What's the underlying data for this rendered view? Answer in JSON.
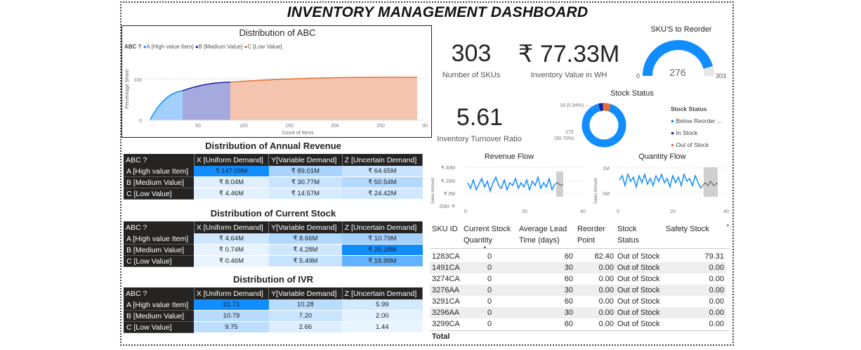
{
  "dashboard_title": "INVENTORY MANAGEMENT DASHBOARD",
  "abc_chart": {
    "title": "Distribution of ABC",
    "legend_title": "ABC ?",
    "legend": [
      {
        "label": "A [High value Item]",
        "color": "#118DFF"
      },
      {
        "label": "B [Medium Value]",
        "color": "#12239E"
      },
      {
        "label": "C [Low Value]",
        "color": "#E66C37"
      }
    ],
    "ylabel": "Percentage Share",
    "xlabel": "Count of Items",
    "y_ticks": [
      "0",
      "100"
    ],
    "x_ticks": [
      "50",
      "100",
      "150",
      "200",
      "250",
      "30"
    ]
  },
  "kpis": {
    "sku_count": {
      "value": "303",
      "label": "Number of SKUs"
    },
    "inventory_value": {
      "value": "₹ 77.33M",
      "label": "Inventory Value in WH"
    },
    "turnover": {
      "value": "5.61",
      "label": "Inventory Turnover Ratio"
    }
  },
  "gauge": {
    "title": "SKU'S to Reorder",
    "min": "0",
    "max": "303",
    "value": "276",
    "fraction": 0.911
  },
  "stock_status": {
    "title": "Stock Status",
    "legend_title": "Stock Status",
    "label_top": "18 (5.94%)",
    "label_bottom_1": "275",
    "label_bottom_2": "(90.76%)",
    "items": [
      {
        "label": "Below Reorder ...",
        "color": "#118DFF",
        "value": 275
      },
      {
        "label": "In Stock",
        "color": "#12239E",
        "value": 10
      },
      {
        "label": "Out of Stock",
        "color": "#E66C37",
        "value": 18
      }
    ]
  },
  "revenue_flow": {
    "title": "Revenue Flow",
    "ylabel": "Sales Amount",
    "y_ticks": [
      "₹ 40M",
      "₹ 20M",
      "₹ 0M",
      "20M -₹"
    ],
    "x_ticks": [
      "0",
      "20",
      "40"
    ]
  },
  "quantity_flow": {
    "title": "Quantity Flow",
    "ylabel": "Sales Amount",
    "y_ticks": [
      "1M",
      "0M"
    ],
    "x_ticks": [
      "0",
      "20",
      "40"
    ]
  },
  "matrices": {
    "columns": [
      "ABC ?",
      "X [Uniform Demand]",
      "Y[Variable Demand]",
      "Z [Uncertain Demand]"
    ],
    "rows": [
      "A [High value Item]",
      "B [Medium Value]",
      "C [Low Value]"
    ],
    "revenue": {
      "title": "Distribution of Annual Revenue",
      "values": [
        [
          "₹ 147.09M",
          "₹ 89.01M",
          "₹ 64.65M"
        ],
        [
          "₹ 8.04M",
          "₹ 30.77M",
          "₹ 50.54M"
        ],
        [
          "₹ 4.46M",
          "₹ 14.57M",
          "₹ 24.42M"
        ]
      ],
      "colors": [
        [
          "#118DFF",
          "#a9d4ff",
          "#c7e3ff"
        ],
        [
          "#dfefff",
          "#c9e4ff",
          "#b3d9ff"
        ],
        [
          "#e3f1ff",
          "#d6ebff",
          "#cfe7ff"
        ]
      ]
    },
    "stock": {
      "title": "Distribution of Current Stock",
      "values": [
        [
          "₹ 4.64M",
          "₹ 8.66M",
          "₹ 10.79M"
        ],
        [
          "₹ 0.74M",
          "₹ 4.28M",
          "₹ 25.28M"
        ],
        [
          "₹ 0.46M",
          "₹ 5.49M",
          "₹ 16.99M"
        ]
      ],
      "colors": [
        [
          "#cfe7ff",
          "#b1d8ff",
          "#a4d1ff"
        ],
        [
          "#e6f3ff",
          "#cfe7ff",
          "#118DFF"
        ],
        [
          "#e8f4ff",
          "#c5e2ff",
          "#62b3ff"
        ]
      ]
    },
    "ivr": {
      "title": "Distribution of IVR",
      "values": [
        [
          "31.71",
          "10.28",
          "5.99"
        ],
        [
          "10.79",
          "7.20",
          "2.00"
        ],
        [
          "9.75",
          "2.66",
          "1.44"
        ]
      ],
      "colors": [
        [
          "#118DFF",
          "#b9dcff",
          "#d3e9ff"
        ],
        [
          "#b8dcff",
          "#c9e4ff",
          "#e4f1ff"
        ],
        [
          "#bddeff",
          "#deeeff",
          "#e8f4ff"
        ]
      ]
    }
  },
  "sku_table": {
    "headers": [
      "SKU ID",
      "Current Stock Quantity",
      "Average Lead Time (days)",
      "Reorder Point",
      "Stock Status",
      "Safety Stock"
    ],
    "header_lines": [
      [
        "SKU ID"
      ],
      [
        "Current Stock",
        "Quantity"
      ],
      [
        "Average Lead",
        "Time (days)"
      ],
      [
        "Reorder",
        "Point"
      ],
      [
        "Stock",
        "Status"
      ],
      [
        "Safety Stock"
      ]
    ],
    "rows": [
      [
        "1283CA",
        "0",
        "60",
        "82.40",
        "Out of Stock",
        "79.31"
      ],
      [
        "1491CA",
        "0",
        "30",
        "0.00",
        "Out of Stock",
        "0.00"
      ],
      [
        "3274CA",
        "0",
        "60",
        "0.00",
        "Out of Stock",
        "0.00"
      ],
      [
        "3276AA",
        "0",
        "30",
        "0.00",
        "Out of Stock",
        "0.00"
      ],
      [
        "3291CA",
        "0",
        "60",
        "0.00",
        "Out of Stock",
        "0.00"
      ],
      [
        "3296AA",
        "0",
        "30",
        "0.00",
        "Out of Stock",
        "0.00"
      ],
      [
        "3299CA",
        "0",
        "60",
        "0.00",
        "Out of Stock",
        "0.00"
      ]
    ],
    "total_label": "Total"
  }
}
